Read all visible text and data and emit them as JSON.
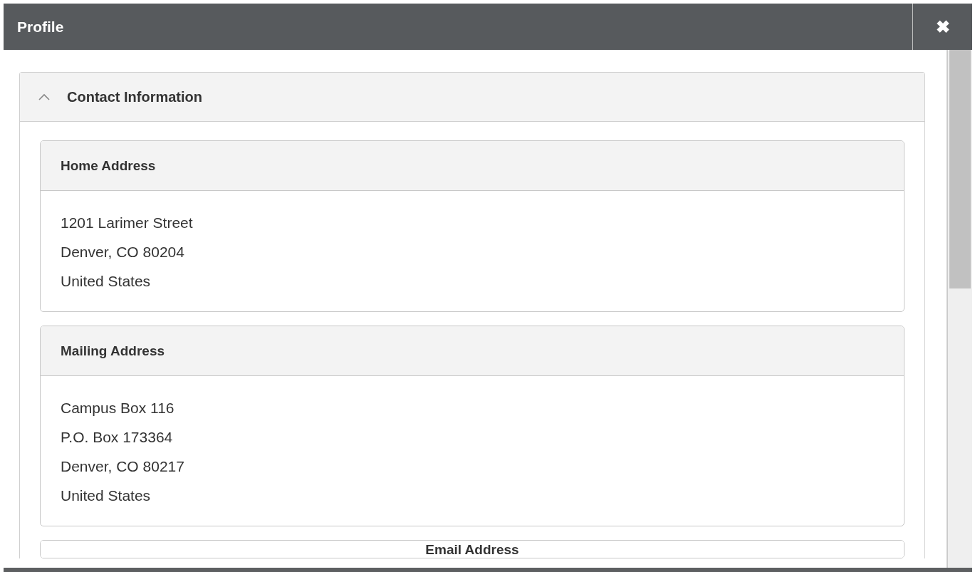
{
  "window": {
    "title": "Profile",
    "close_label": "✖"
  },
  "section": {
    "title": "Contact Information",
    "expanded": true,
    "cards": [
      {
        "kind": "address",
        "heading": "Home Address",
        "lines": [
          "1201 Larimer Street",
          "Denver, CO 80204",
          "United States"
        ]
      },
      {
        "kind": "address",
        "heading": "Mailing Address",
        "lines": [
          "Campus Box 116",
          "P.O. Box 173364",
          "Denver, CO 80217",
          "United States"
        ]
      },
      {
        "kind": "centered",
        "heading": "Email Address"
      }
    ]
  }
}
